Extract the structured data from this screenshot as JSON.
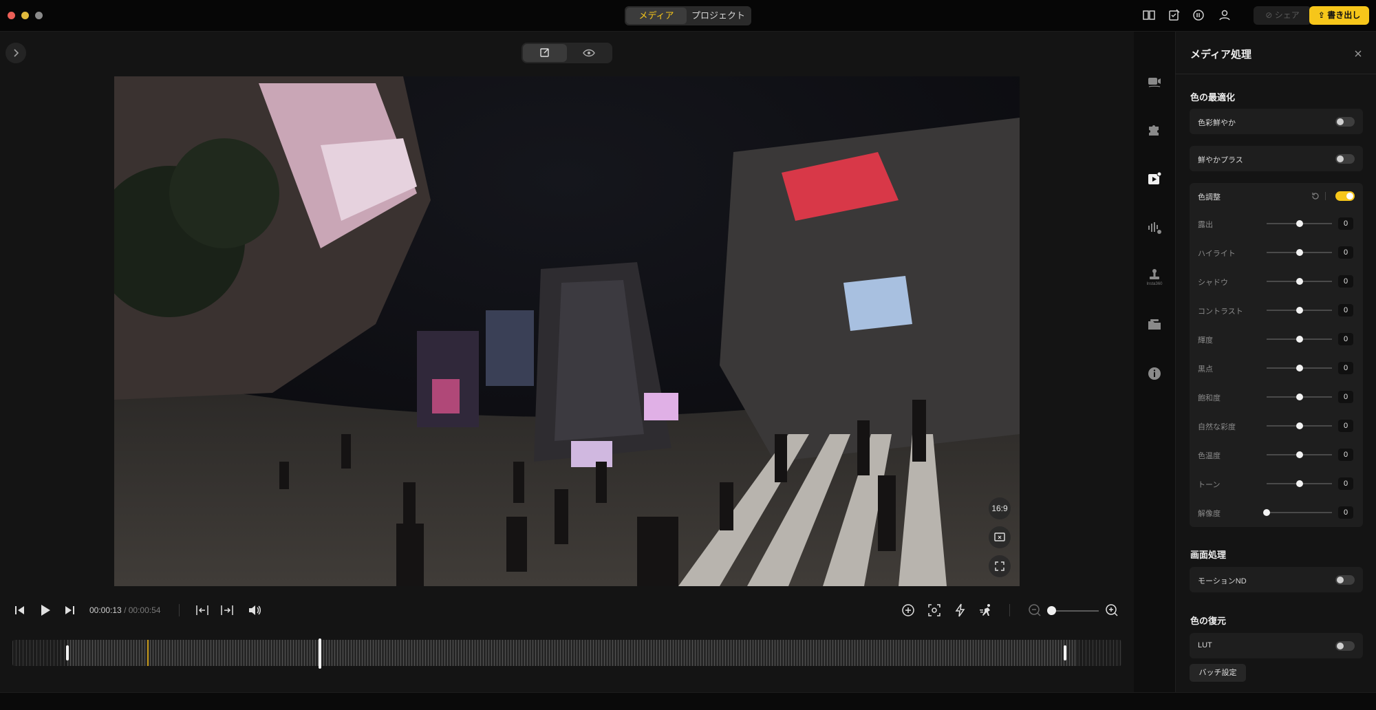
{
  "titlebar": {
    "tabs": [
      {
        "label": "メディア",
        "active": true
      },
      {
        "label": "プロジェクト",
        "active": false
      }
    ],
    "share_label": "シェア",
    "export_label": "書き出し",
    "icons": [
      "book-icon",
      "edit-check-icon",
      "badge-icon",
      "user-icon"
    ],
    "accent_color": "#f6c61a"
  },
  "preview": {
    "aspect_label": "16:9",
    "view_modes": [
      "edit-icon",
      "eye-icon"
    ]
  },
  "player": {
    "current_time": "00:00:13",
    "separator": "/",
    "total_time": "00:00:54",
    "zoom_level": 0.0
  },
  "timeline": {
    "playhead_fraction": 0.14,
    "marker_fraction": 0.28
  },
  "rail": {
    "items": [
      "video-icon",
      "puzzle-icon",
      "media-processing-icon",
      "audio-settings-icon",
      "stamp-icon",
      "folder-icon",
      "info-icon"
    ],
    "sublabel": "Insta360",
    "active_index": 2
  },
  "panel": {
    "title": "メディア処理",
    "sections": {
      "color_opt": {
        "title": "色の最適化",
        "vivid": {
          "label": "色彩鮮やか",
          "on": false
        },
        "vivid_plus": {
          "label": "鮮やかプラス",
          "on": false
        },
        "adjust": {
          "label": "色調整",
          "on": true
        }
      },
      "adjust_rows": [
        {
          "label": "露出",
          "value": "0",
          "pos": 0.5
        },
        {
          "label": "ハイライト",
          "value": "0",
          "pos": 0.5
        },
        {
          "label": "シャドウ",
          "value": "0",
          "pos": 0.5
        },
        {
          "label": "コントラスト",
          "value": "0",
          "pos": 0.5
        },
        {
          "label": "輝度",
          "value": "0",
          "pos": 0.5
        },
        {
          "label": "黒点",
          "value": "0",
          "pos": 0.5
        },
        {
          "label": "飽和度",
          "value": "0",
          "pos": 0.5
        },
        {
          "label": "自然な彩度",
          "value": "0",
          "pos": 0.5
        },
        {
          "label": "色温度",
          "value": "0",
          "pos": 0.5
        },
        {
          "label": "トーン",
          "value": "0",
          "pos": 0.5
        },
        {
          "label": "解像度",
          "value": "0",
          "pos": 0.0
        }
      ],
      "screen": {
        "title": "画面処理",
        "motion_nd": {
          "label": "モーションND",
          "on": false
        }
      },
      "restore": {
        "title": "色の復元",
        "lut": {
          "label": "LUT",
          "on": false
        }
      }
    },
    "batch_label": "バッチ設定"
  }
}
